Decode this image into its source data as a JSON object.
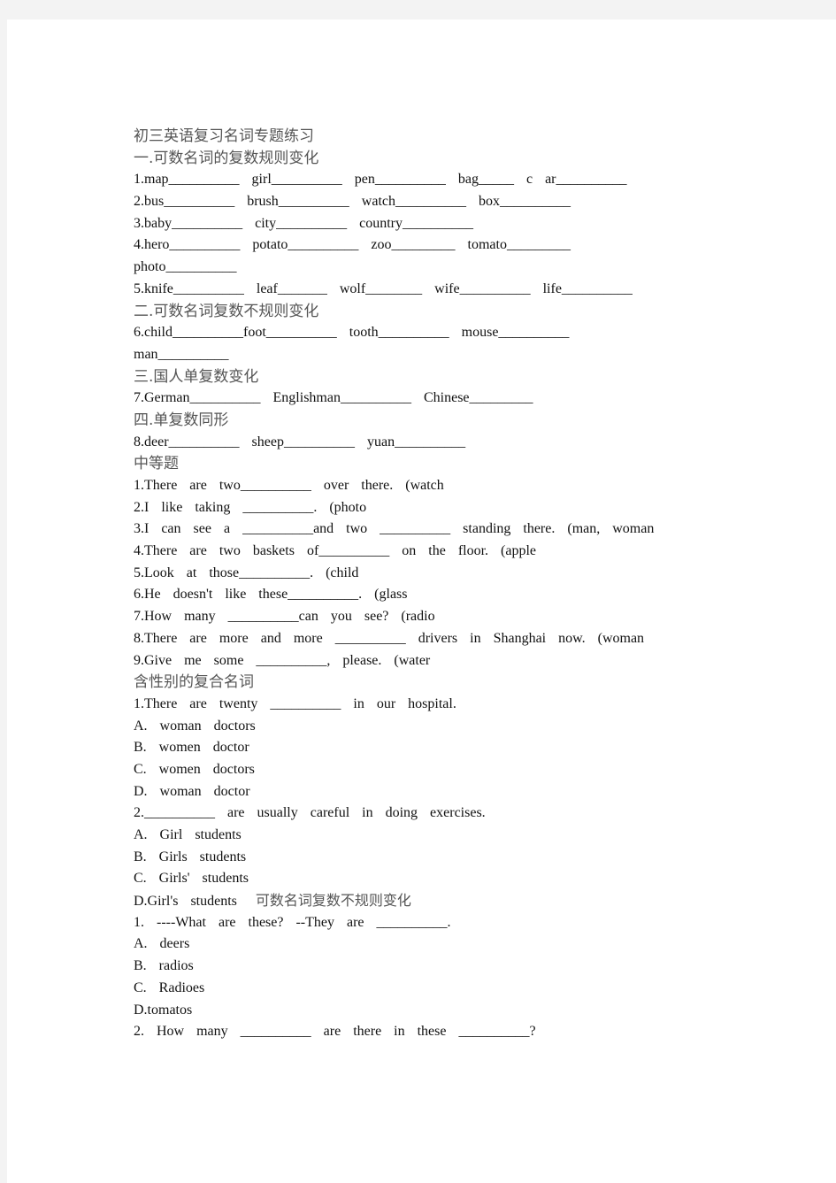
{
  "document": {
    "title": "初三英语复习名词专题练习",
    "sections": [
      {
        "heading": "一.可数名词的复数规则变化"
      },
      {
        "heading": "二.可数名词复数不规则变化"
      },
      {
        "heading": "三.国人单复数变化"
      },
      {
        "heading": "四.单复数同形"
      },
      {
        "heading": "中等题"
      },
      {
        "heading": "含性别的复合名词"
      }
    ],
    "lines": {
      "l1": "1.map__________  girl__________  pen__________  bag_____  c  ar__________",
      "l2": "2.bus__________  brush__________  watch__________  box__________",
      "l3": "3.baby__________  city__________  country__________",
      "l4": "4.hero__________  potato__________  zoo_________  tomato_________",
      "l5": "photo__________",
      "l6": "5.knife__________  leaf_______  wolf________  wife__________  life__________",
      "l7": "6.child__________foot__________  tooth__________  mouse__________",
      "l8": "man__________",
      "l9": "7.German__________  Englishman__________  Chinese_________",
      "l10": "8.deer__________  sheep__________  yuan__________",
      "m1": "1.There  are  two__________  over  there.  (watch",
      "m2": "2.I  like  taking  __________.  (photo",
      "m3": "3.I  can  see  a  __________and  two  __________  standing  there.  (man,  woman",
      "m4": "4.There  are  two  baskets  of__________  on  the  floor.  (apple",
      "m5": "5.Look  at  those__________.  (child",
      "m6": "6.He  doesn't  like  these__________.  (glass",
      "m7": "7.How  many  __________can  you  see?  (radio",
      "m8": "8.There  are  more  and  more  __________  drivers  in  Shanghai  now.  (woman",
      "m9": "9.Give  me  some  __________,  please.  (water",
      "g1": "1.There  are  twenty  __________  in  our  hospital.",
      "g1a": "A.  woman  doctors",
      "g1b": "B.  women  doctor",
      "g1c": "C.  women  doctors",
      "g1d": "D.  woman  doctor",
      "g2": "2.__________  are  usually  careful  in  doing  exercises.",
      "g2a": "A.  Girl  students",
      "g2b": "B.  Girls  students",
      "g2c": "C.  Girls'  students",
      "g2d": "D.Girl's  students",
      "g2d_heading": "可数名词复数不规则变化",
      "i1": "1.  ----What  are  these?  --They  are  __________.",
      "i1a": "A.  deers",
      "i1b": "B.  radios",
      "i1c": "C.  Radioes",
      "i1d": "D.tomatos",
      "i2": "2.  How  many  __________  are  there  in  these  __________?"
    }
  }
}
